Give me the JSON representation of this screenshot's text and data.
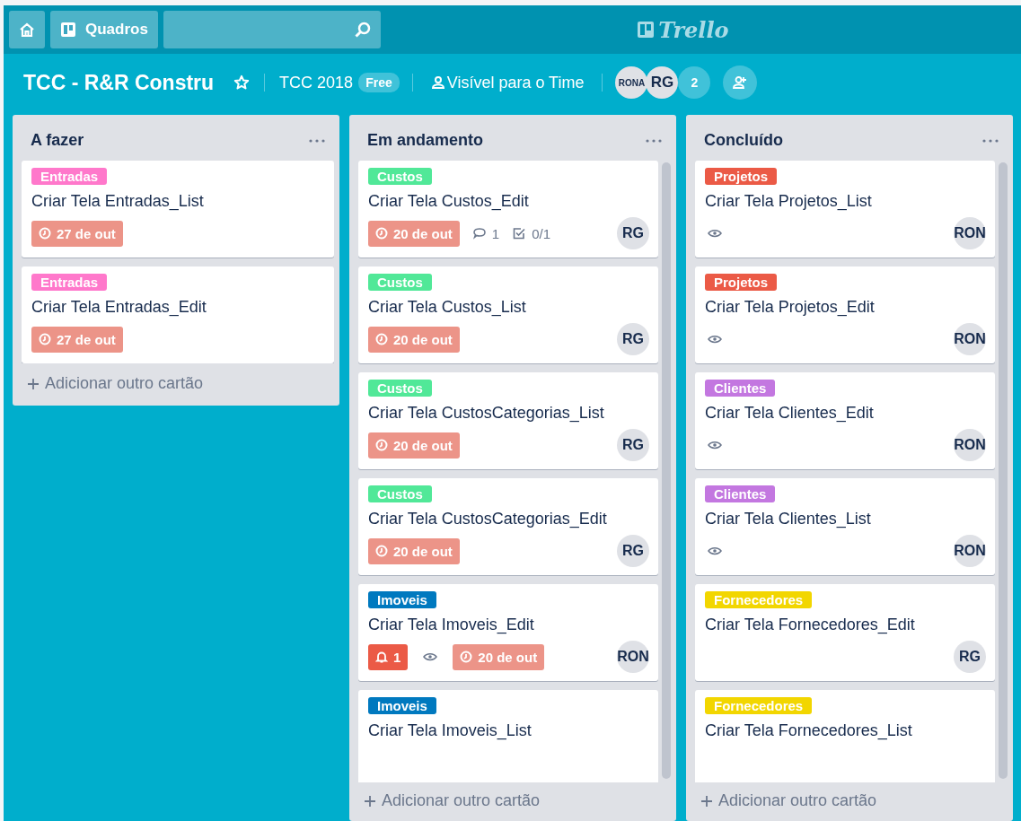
{
  "top_bar": {
    "boards_button": "Quadros",
    "logo": "Trello"
  },
  "board_header": {
    "title": "TCC - R&R Constru",
    "starred": false,
    "team": "TCC 2018",
    "plan_badge": "Free",
    "visibility": "Visível para o Time",
    "members": [
      "RONA",
      "RG"
    ],
    "more_members": "2"
  },
  "lists": [
    {
      "title": "A fazer",
      "scrollable": false,
      "add_card": "Adicionar outro cartão",
      "cards": [
        {
          "label": {
            "text": "Entradas",
            "color": "#ff78cb"
          },
          "title": "Criar Tela Entradas_List",
          "badges": [
            {
              "kind": "due",
              "text": "27 de out"
            }
          ]
        },
        {
          "label": {
            "text": "Entradas",
            "color": "#ff78cb"
          },
          "title": "Criar Tela Entradas_Edit",
          "badges": [
            {
              "kind": "due",
              "text": "27 de out"
            }
          ]
        }
      ]
    },
    {
      "title": "Em andamento",
      "scrollable": true,
      "add_card": "Adicionar outro cartão",
      "cards": [
        {
          "label": {
            "text": "Custos",
            "color": "#51e898"
          },
          "title": "Criar Tela Custos_Edit",
          "badges": [
            {
              "kind": "due",
              "text": "20 de out"
            },
            {
              "kind": "comments",
              "text": "1"
            },
            {
              "kind": "checklist",
              "text": "0/1"
            }
          ],
          "member": "RG"
        },
        {
          "label": {
            "text": "Custos",
            "color": "#51e898"
          },
          "title": "Criar Tela Custos_List",
          "badges": [
            {
              "kind": "due",
              "text": "20 de out"
            }
          ],
          "member": "RG"
        },
        {
          "label": {
            "text": "Custos",
            "color": "#51e898"
          },
          "title": "Criar Tela CustosCategorias_List",
          "badges": [
            {
              "kind": "due",
              "text": "20 de out"
            }
          ],
          "member": "RG"
        },
        {
          "label": {
            "text": "Custos",
            "color": "#51e898"
          },
          "title": "Criar Tela CustosCategorias_Edit",
          "badges": [
            {
              "kind": "due",
              "text": "20 de out"
            }
          ],
          "member": "RG"
        },
        {
          "label": {
            "text": "Imoveis",
            "color": "#0079bf"
          },
          "title": "Criar Tela Imoveis_Edit",
          "badges": [
            {
              "kind": "notifications",
              "text": "1"
            },
            {
              "kind": "watch"
            },
            {
              "kind": "due",
              "text": "20 de out"
            }
          ],
          "member": "RON"
        },
        {
          "label": {
            "text": "Imoveis",
            "color": "#0079bf"
          },
          "title": "Criar Tela Imoveis_List"
        }
      ]
    },
    {
      "title": "Concluído",
      "scrollable": true,
      "add_card": "Adicionar outro cartão",
      "cards": [
        {
          "label": {
            "text": "Projetos",
            "color": "#eb5a46"
          },
          "title": "Criar Tela Projetos_List",
          "badges": [
            {
              "kind": "watch"
            }
          ],
          "member": "RON"
        },
        {
          "label": {
            "text": "Projetos",
            "color": "#eb5a46"
          },
          "title": "Criar Tela Projetos_Edit",
          "badges": [
            {
              "kind": "watch"
            }
          ],
          "member": "RON"
        },
        {
          "label": {
            "text": "Clientes",
            "color": "#c377e0"
          },
          "title": "Criar Tela Clientes_Edit",
          "badges": [
            {
              "kind": "watch"
            }
          ],
          "member": "RON"
        },
        {
          "label": {
            "text": "Clientes",
            "color": "#c377e0"
          },
          "title": "Criar Tela Clientes_List",
          "badges": [
            {
              "kind": "watch"
            }
          ],
          "member": "RON"
        },
        {
          "label": {
            "text": "Fornecedores",
            "color": "#f2d600"
          },
          "title": "Criar Tela Fornecedores_Edit",
          "member": "RG"
        },
        {
          "label": {
            "text": "Fornecedores",
            "color": "#f2d600"
          },
          "title": "Criar Tela Fornecedores_List"
        }
      ]
    }
  ]
}
